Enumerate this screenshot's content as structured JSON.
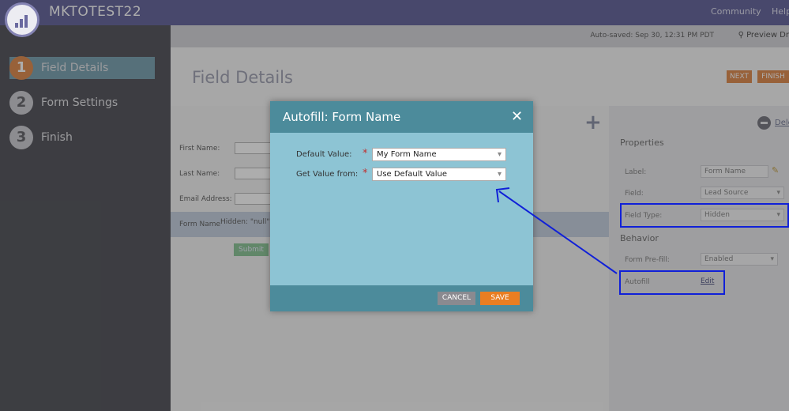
{
  "app": {
    "title": "MKTOTEST22"
  },
  "top_links": {
    "community": "Community",
    "help": "Help"
  },
  "subbar": {
    "autosaved": "Auto-saved: Sep 30, 12:31 PM PDT",
    "preview": "Preview Dr"
  },
  "steps": [
    {
      "number": "1",
      "label": "Field Details"
    },
    {
      "number": "2",
      "label": "Form Settings"
    },
    {
      "number": "3",
      "label": "Finish"
    }
  ],
  "main": {
    "title": "Field Details",
    "next_label": "NEXT",
    "finish_label": "FINISH"
  },
  "form": {
    "first_name": "First Name:",
    "last_name": "Last Name:",
    "email": "Email Address:",
    "form_name": "Form Name",
    "hidden_value": "Hidden: \"null\"",
    "submit": "Submit"
  },
  "properties": {
    "delete_label": "Dele",
    "properties_title": "Properties",
    "behavior_title": "Behavior",
    "label_label": "Label:",
    "label_value": "Form Name",
    "field_label": "Field:",
    "field_value": "Lead Source",
    "field_type_label": "Field Type:",
    "field_type_value": "Hidden",
    "prefill_label": "Form Pre-fill:",
    "prefill_value": "Enabled",
    "autofill_label": "Autofill",
    "autofill_edit": "Edit"
  },
  "modal": {
    "title": "Autofill: Form Name",
    "default_value_label": "Default Value:",
    "default_value": "My Form Name",
    "get_value_label": "Get Value from:",
    "get_value": "Use Default Value",
    "required_mark": "*",
    "cancel": "CANCEL",
    "save": "SAVE"
  },
  "colors": {
    "topbar": "#6b6aa0",
    "modal_header": "#4c8b9b",
    "modal_body": "#8dc4d4",
    "accent_orange": "#e08f55",
    "save_orange": "#e97e22",
    "annotation_blue": "#1020d8"
  }
}
